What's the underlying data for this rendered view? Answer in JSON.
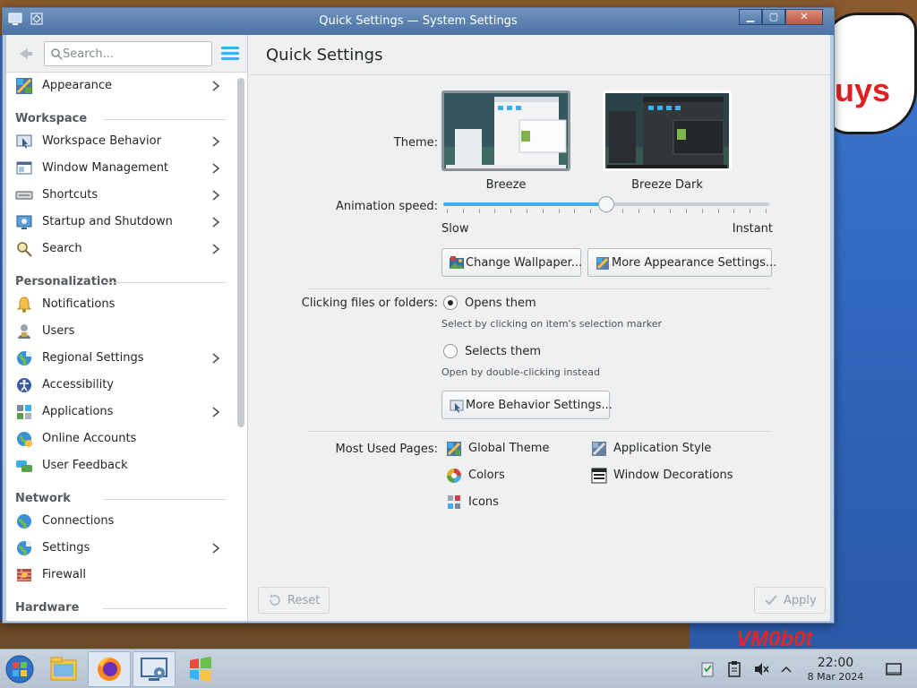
{
  "window": {
    "title": "Quick Settings — System Settings",
    "minimize_glyph": "▁",
    "maximize_glyph": "▢",
    "close_glyph": "✕"
  },
  "sidebar": {
    "search_placeholder": "Search...",
    "items": [
      {
        "label": "Appearance",
        "icon": "appearance-icon",
        "chevron": true
      },
      {
        "header": "Workspace"
      },
      {
        "label": "Workspace Behavior",
        "icon": "workspace-behavior-icon",
        "chevron": true
      },
      {
        "label": "Window Management",
        "icon": "window-management-icon",
        "chevron": true
      },
      {
        "label": "Shortcuts",
        "icon": "keyboard-icon",
        "chevron": true
      },
      {
        "label": "Startup and Shutdown",
        "icon": "startup-icon",
        "chevron": true
      },
      {
        "label": "Search",
        "icon": "search-icon",
        "chevron": true
      },
      {
        "header": "Personalization"
      },
      {
        "label": "Notifications",
        "icon": "bell-icon",
        "chevron": false
      },
      {
        "label": "Users",
        "icon": "users-icon",
        "chevron": false
      },
      {
        "label": "Regional Settings",
        "icon": "globe-icon",
        "chevron": true
      },
      {
        "label": "Accessibility",
        "icon": "accessibility-icon",
        "chevron": false
      },
      {
        "label": "Applications",
        "icon": "applications-icon",
        "chevron": true
      },
      {
        "label": "Online Accounts",
        "icon": "online-accounts-icon",
        "chevron": false
      },
      {
        "label": "User Feedback",
        "icon": "feedback-icon",
        "chevron": false
      },
      {
        "header": "Network"
      },
      {
        "label": "Connections",
        "icon": "connections-icon",
        "chevron": false
      },
      {
        "label": "Settings",
        "icon": "network-settings-icon",
        "chevron": true
      },
      {
        "label": "Firewall",
        "icon": "firewall-icon",
        "chevron": false
      },
      {
        "header": "Hardware"
      }
    ]
  },
  "main": {
    "title": "Quick Settings",
    "theme_label": "Theme:",
    "themes": [
      {
        "name": "Breeze",
        "selected": true
      },
      {
        "name": "Breeze Dark",
        "selected": false
      }
    ],
    "animation_label": "Animation speed:",
    "animation_value": 0.5,
    "slow_label": "Slow",
    "instant_label": "Instant",
    "change_wallpaper": "Change Wallpaper...",
    "more_appearance": "More Appearance Settings...",
    "clicking_label": "Clicking files or folders:",
    "opens_them": "Opens them",
    "opens_hint": "Select by clicking on item's selection marker",
    "selects_them": "Selects them",
    "selects_hint": "Open by double-clicking instead",
    "more_behavior": "More Behavior Settings...",
    "most_used_label": "Most Used Pages:",
    "most_used": [
      {
        "label": "Global Theme",
        "icon": "global-theme-icon"
      },
      {
        "label": "Application Style",
        "icon": "application-style-icon"
      },
      {
        "label": "Colors",
        "icon": "colors-icon"
      },
      {
        "label": "Window Decorations",
        "icon": "window-decorations-icon"
      },
      {
        "label": "Icons",
        "icon": "icons-icon"
      }
    ],
    "reset": "Reset",
    "apply": "Apply"
  },
  "desktop": {
    "bubble_text": "uys",
    "logo_text": "VM0b0t"
  },
  "taskbar": {
    "time": "22:00",
    "date": "8 Mar 2024"
  },
  "colors": {
    "accent": "#3daee9",
    "window_frame": "#4a73a5"
  }
}
